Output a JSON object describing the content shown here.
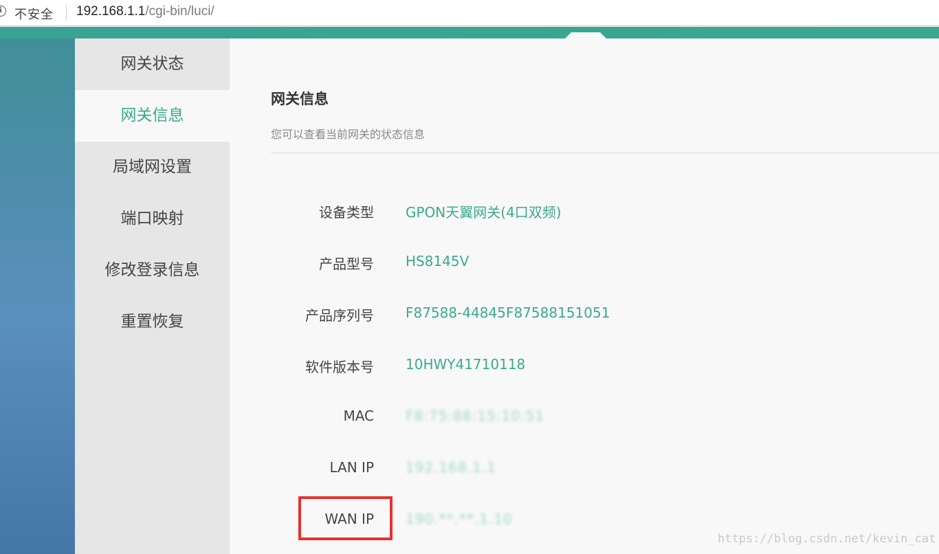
{
  "browser": {
    "security_label": "不安全",
    "url_host": "192.168.1.1",
    "url_path": "/cgi-bin/luci/"
  },
  "sidebar": {
    "items": [
      {
        "label": "网关状态",
        "active": false
      },
      {
        "label": "网关信息",
        "active": true
      },
      {
        "label": "局域网设置",
        "active": false
      },
      {
        "label": "端口映射",
        "active": false
      },
      {
        "label": "修改登录信息",
        "active": false
      },
      {
        "label": "重置恢复",
        "active": false
      }
    ]
  },
  "main": {
    "title": "网关信息",
    "subtitle": "您可以查看当前网关的状态信息",
    "info": [
      {
        "label": "设备类型",
        "value": "GPON天翼网关(4口双频)"
      },
      {
        "label": "产品型号",
        "value": "HS8145V"
      },
      {
        "label": "产品序列号",
        "value": "F87588-44845F87588151051"
      },
      {
        "label": "软件版本号",
        "value": "10HWY41710118"
      },
      {
        "label": "MAC",
        "value": "F8:75:88:15:10:51"
      },
      {
        "label": "LAN IP",
        "value": "192.168.1.1"
      },
      {
        "label": "WAN IP",
        "value": "190.**.**.1.10"
      }
    ]
  },
  "watermark": "https://blog.csdn.net/kevin_cat",
  "colors": {
    "accent": "#3aaa8c",
    "highlight": "#e8322f",
    "sidebar_bg": "#e6e6e6",
    "content_bg": "#f8f8f8"
  }
}
